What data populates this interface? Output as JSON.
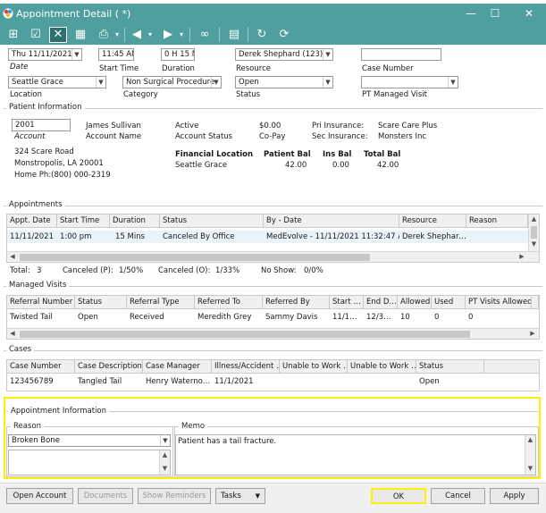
{
  "window": {
    "title": "Appointment Detail ( *)",
    "minimize": "—",
    "maximize": "☐",
    "close": "✕"
  },
  "toolbar": {
    "icons": [
      "grid-icon",
      "check-icon",
      "cancel-icon",
      "calendar-icon",
      "printer-icon",
      "back-icon",
      "forward-icon",
      "binoculars-icon",
      "document-list-icon",
      "undo-icon",
      "refresh-icon"
    ]
  },
  "header": {
    "date_value": "Thu 11/11/2021",
    "date_label": "Date",
    "start_time_value": "11:45 AM",
    "start_time_label": "Start Time",
    "duration_value": "0 H 15 M",
    "duration_label": "Duration",
    "resource_value": "Derek Shephard  (123)",
    "resource_label": "Resource",
    "case_number_value": "",
    "case_number_label": "Case Number",
    "location_value": "Seattle Grace",
    "location_label": "Location",
    "category_value": "Non Surgical Procedure",
    "category_label": "Category",
    "status_value": "Open",
    "status_label": "Status",
    "pt_managed_visit_value": "",
    "pt_managed_visit_label": "PT Managed Visit"
  },
  "patient": {
    "section_title": "Patient Information",
    "account_value": "2001",
    "account_label": "Account",
    "name": "James Sullivan",
    "account_name_label": "Account Name",
    "address1": "324 Scare Road",
    "address2": "Monstropolis, LA 20001",
    "home_phone": "Home Ph:(800) 000-2319",
    "active_label": "Active",
    "account_status_label": "Account Status",
    "balance": "$0.00",
    "copay_label": "Co-Pay",
    "pri_insurance_label": "Pri Insurance:",
    "pri_insurance": "Scare Care Plus",
    "sec_insurance_label": "Sec Insurance:",
    "sec_insurance": "Monsters Inc",
    "financial_location_label": "Financial Location",
    "financial_location": "Seattle Grace",
    "patient_bal_label": "Patient Bal",
    "patient_bal": "42.00",
    "ins_bal_label": "Ins Bal",
    "ins_bal": "0.00",
    "total_bal_label": "Total Bal",
    "total_bal": "42.00"
  },
  "appointments": {
    "section_title": "Appointments",
    "columns": [
      "Appt. Date",
      "Start Time",
      "Duration",
      "Status",
      "By - Date",
      "Resource",
      "Reason"
    ],
    "rows": [
      [
        "11/11/2021",
        "1:00 pm",
        "15 Mins",
        "Canceled By Office",
        "MedEvolve - 11/11/2021 11:32:47 AM",
        "Derek  Shephar…",
        ""
      ]
    ],
    "summary": {
      "total_label": "Total:",
      "total": "3",
      "canceled_p_label": "Canceled (P):",
      "canceled_p": "1/50%",
      "canceled_o_label": "Canceled (O):",
      "canceled_o": "1/33%",
      "no_show_label": "No Show:",
      "no_show": "0/0%"
    }
  },
  "managed_visits": {
    "section_title": "Managed Visits",
    "columns": [
      "Referral Number",
      "Status",
      "Referral Type",
      "Referred To",
      "Referred By",
      "Start …",
      "End D…",
      "Allowed",
      "Used",
      "PT Visits Allowed",
      ""
    ],
    "rows": [
      [
        "Twisted Tail",
        "Open",
        "Received",
        "Meredith Grey",
        "Sammy Davis",
        "11/1…",
        "12/3…",
        "10",
        "0",
        "0",
        ""
      ]
    ]
  },
  "cases": {
    "section_title": "Cases",
    "columns": [
      "Case Number",
      "Case Description",
      "Case Manager",
      "Illness/Accident …",
      "Unable to Work …",
      "Unable to Work …",
      "Status"
    ],
    "rows": [
      [
        "123456789",
        "Tangled Tail",
        "Henry Waterno…",
        "11/1/2021",
        "",
        "",
        "Open"
      ]
    ]
  },
  "appointment_info": {
    "section_title": "Appointment Information",
    "reason_label": "Reason",
    "reason_value": "Broken Bone",
    "memo_label": "Memo",
    "memo_value": "Patient has a tail fracture."
  },
  "footer": {
    "open_account": "Open Account",
    "documents": "Documents",
    "show_reminders": "Show Reminders",
    "tasks": "Tasks",
    "ok": "OK",
    "cancel": "Cancel",
    "apply": "Apply"
  }
}
